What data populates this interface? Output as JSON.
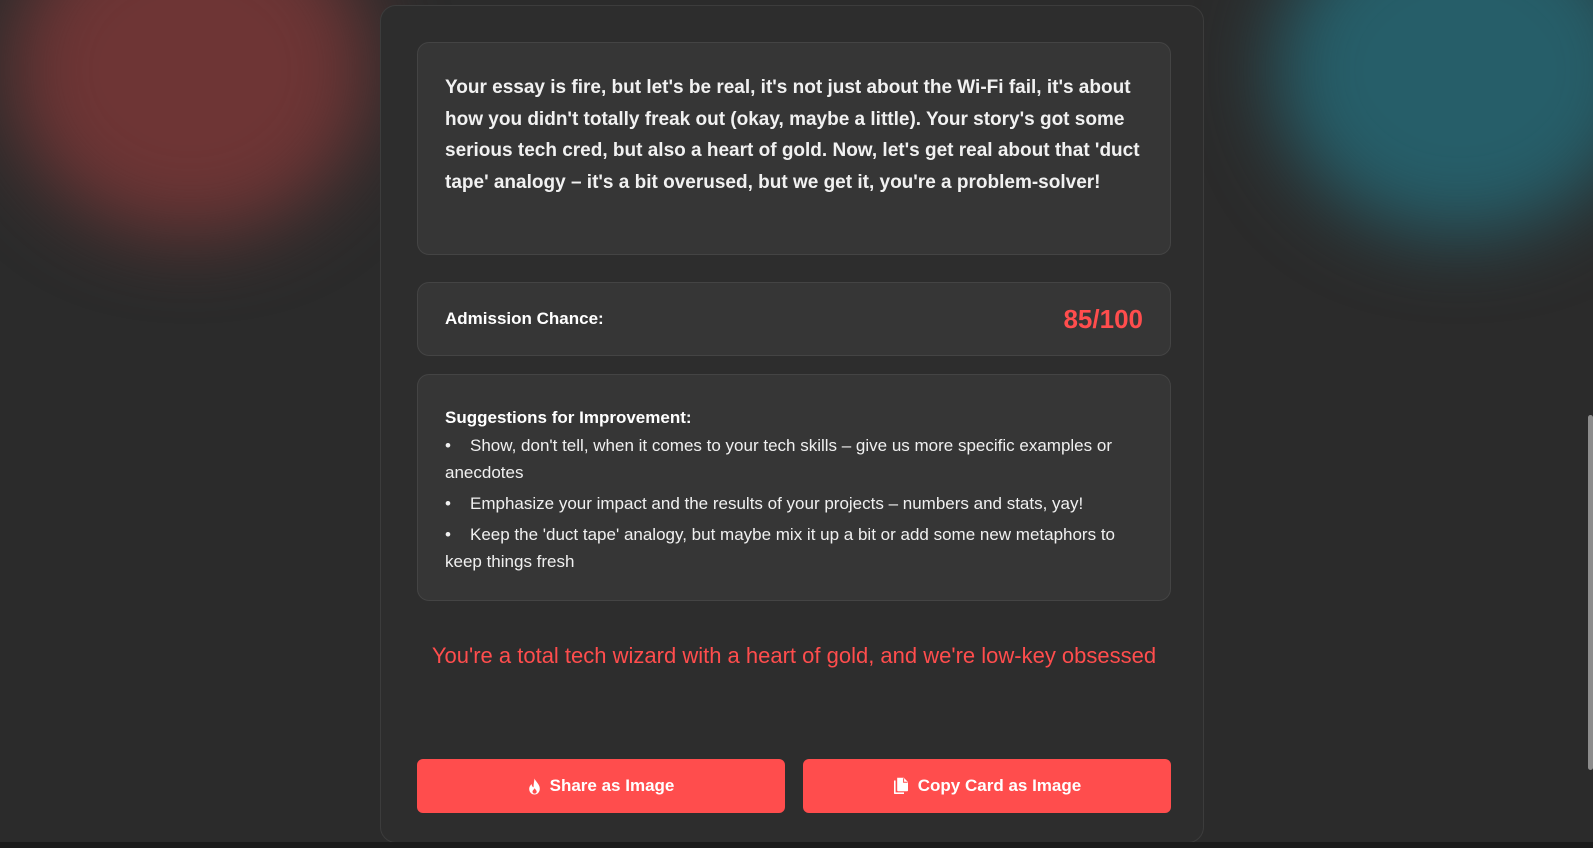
{
  "feedback": {
    "text": "Your essay is fire, but let's be real, it's not just about the Wi-Fi fail, it's about how you didn't totally freak out (okay, maybe a little). Your story's got some serious tech cred, but also a heart of gold. Now, let's get real about that 'duct tape' analogy – it's a bit overused, but we get it, you're a problem-solver!"
  },
  "score": {
    "label": "Admission Chance:",
    "value": "85/100"
  },
  "suggestions": {
    "title": "Suggestions for Improvement:",
    "bullet": "•",
    "items": [
      "Show, don't tell, when it comes to your tech skills – give us more specific examples or anecdotes",
      "Emphasize your impact and the results of your projects – numbers and stats, yay!",
      "Keep the 'duct tape' analogy, but maybe mix it up a bit or add some new metaphors to keep things fresh"
    ]
  },
  "tagline": "You're a total tech wizard with a heart of gold, and we're low-key obsessed",
  "buttons": {
    "share": {
      "label": "Share as Image",
      "icon": "fire-icon"
    },
    "copy": {
      "label": "Copy Card as Image",
      "icon": "copy-icon"
    }
  },
  "colors": {
    "accent": "#ff4d4d",
    "background": "#2b2b2b",
    "card": "#2d2d2d",
    "panel": "#363636"
  }
}
